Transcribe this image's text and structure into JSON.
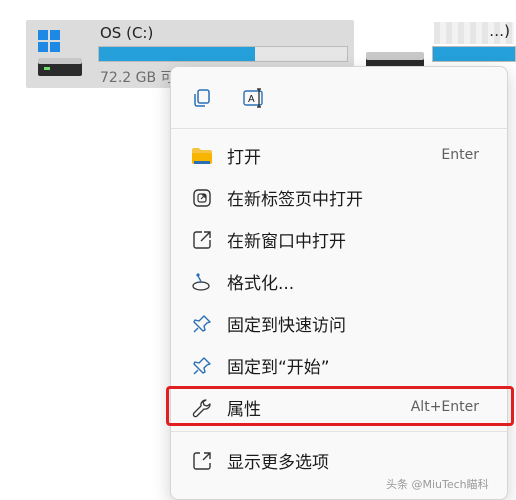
{
  "drives": [
    {
      "name": "OS (C:)",
      "free_text": "72.2 GB 可",
      "used_fraction": 0.63
    },
    {
      "name": "…)",
      "used_fraction": 1.0
    }
  ],
  "quick_actions": [
    {
      "icon": "copy-icon",
      "label": ""
    },
    {
      "icon": "rename-icon",
      "label": ""
    }
  ],
  "menu": {
    "items": [
      {
        "icon": "folder-icon",
        "label": "打开",
        "shortcut": "Enter"
      },
      {
        "icon": "open-new-tab-icon",
        "label": "在新标签页中打开",
        "shortcut": ""
      },
      {
        "icon": "open-new-window-icon",
        "label": "在新窗口中打开",
        "shortcut": ""
      },
      {
        "icon": "format-icon",
        "label": "格式化...",
        "shortcut": ""
      },
      {
        "icon": "pin-icon",
        "label": "固定到快速访问",
        "shortcut": ""
      },
      {
        "icon": "pin-icon",
        "label": "固定到“开始”",
        "shortcut": ""
      },
      {
        "icon": "wrench-icon",
        "label": "属性",
        "shortcut": "Alt+Enter"
      },
      {
        "icon": "more-options-icon",
        "label": "显示更多选项",
        "shortcut": ""
      }
    ]
  },
  "watermark": "头条 @MiuTech瞄科",
  "colors": {
    "accent": "#26a0da",
    "highlight_border": "#e02020",
    "folder": "#f5c542"
  }
}
